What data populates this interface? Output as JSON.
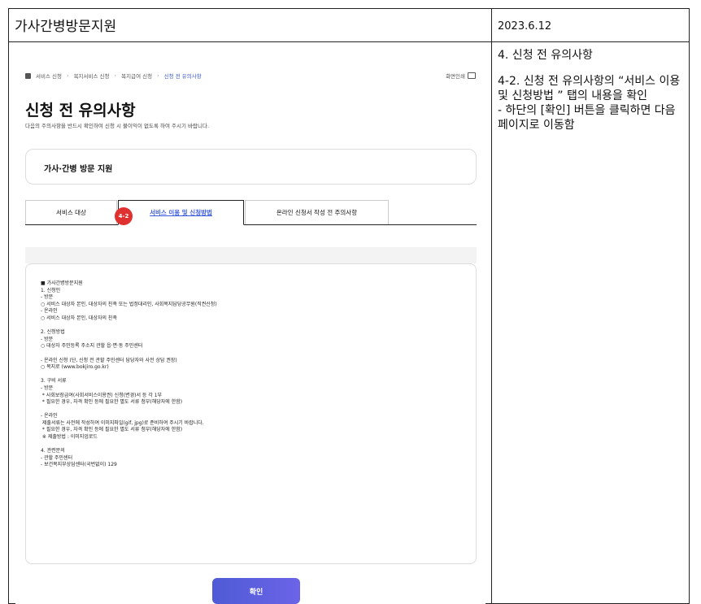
{
  "header": {
    "title": "가사간병방문지원",
    "date": "2023.6.12"
  },
  "notes": {
    "heading": "4. 신청 전 유의사항",
    "body": "4-2. 신청 전 유의사항의 “서비스 이용 및 신청방법 ”  탭의 내용을 확인\n - 하단의 [확인] 버튼을 클릭하면 다음페이지로 이동함"
  },
  "screen": {
    "breadcrumb": [
      "서비스 신청",
      "복지서비스 신청",
      "복지급여 신청",
      "신청 전 유의사항"
    ],
    "print_label": "화면인쇄",
    "page_title": "신청 전 유의사항",
    "page_desc": "다음의 주의사항을 반드시 확인하여 신청 시 불이익이 없도록 하여 주시기 바랍니다.",
    "service_name": "가사·간병 방문 지원",
    "tabs": [
      "서비스 대상",
      "서비스 이용 및 신청방법",
      "온라인 신청서 작성 전 주의사항"
    ],
    "badge": "4-2",
    "content_lines": [
      "■ 가사간병방문지원",
      "1. 신청인",
      "- 방문",
      "○ 서비스 대상자 본인, 대상자의 친족 또는 법정대리인, 사회복지담당공무원(직권신청)",
      "- 온라인",
      "○ 서비스 대상자 본인, 대상자의 친족",
      "",
      "2. 신청방법",
      "- 방문",
      "○ 대상자 주민등록 주소지 관할 읍·면·동 주민센터",
      "",
      "- 온라인 신청 (단, 신청 전 관할 주민센터 담당자와 사전 상담 권장)",
      "○ 복지로 (www.bokjiro.go.kr)",
      "",
      "3. 구비 서류",
      "- 방문",
      " * 사회보장급여(사회서비스이용권) 신청(변경)서 등 각 1부",
      " * 필요한 경우, 자격 확인 등에 필요한 별도 서류 첨부(해당자에 한함)",
      "",
      "- 온라인",
      " 제출서류는 사전에 작성하여 이미지파일(gif, jpg)로 준비하여 주시기 바랍니다.",
      " * 필요한 경우, 자격 확인 등에 필요한 별도 서류 첨부(해당자에 한함)",
      " ※ 제출방법 : 이미지업로드",
      "",
      "4. 관련문의",
      "- 관할 주민센터",
      "- 보건복지부상담센터(국번없이) 129"
    ],
    "confirm_label": "확인"
  }
}
